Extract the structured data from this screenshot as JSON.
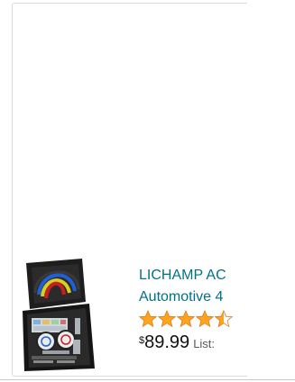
{
  "product": {
    "title_line1": "LICHAMP AC",
    "title_line2": "Automotive 4",
    "rating": 4.5,
    "rating_max": 5,
    "price_symbol": "$",
    "price_value": "89.99",
    "list_label": "List:",
    "star_color": "#ffa41c",
    "link_color": "#007185",
    "image_icon": "ac-manifold-gauge-kit-case-image"
  }
}
